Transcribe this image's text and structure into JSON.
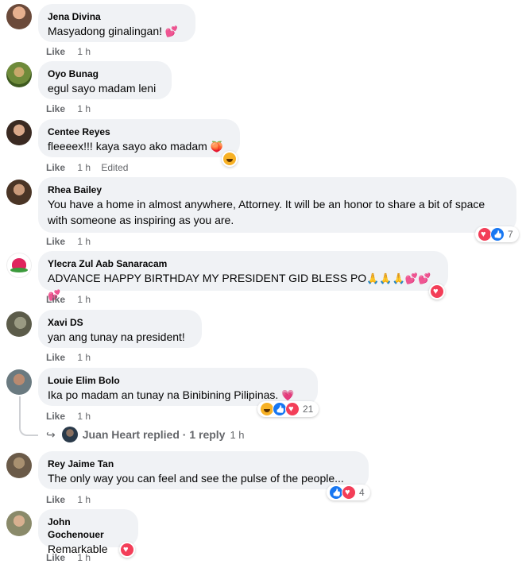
{
  "comments": [
    {
      "author": "Jena Divina",
      "text": "Masyadong ginalingan! ",
      "like": "Like",
      "time": "1 h"
    },
    {
      "author": "Oyo Bunag",
      "text": "egul sayo madam leni",
      "like": "Like",
      "time": "1 h"
    },
    {
      "author": "Centee Reyes",
      "text": "fleeeex!!! kaya sayo ako madam ",
      "like": "Like",
      "time": "1 h",
      "edited": "Edited"
    },
    {
      "author": "Rhea Bailey",
      "text": "You have a home in almost anywhere, Attorney. It will be an honor to share a bit of space with someone as inspiring as you are.",
      "like": "Like",
      "time": "1 h",
      "reaction_count": "7"
    },
    {
      "author": "Ylecra Zul Aab Sanaracam",
      "text": "ADVANCE HAPPY BIRTHDAY MY PRESIDENT GID BLESS PO",
      "like": "Like",
      "time": "1 h"
    },
    {
      "author": "Xavi DS",
      "text": "yan ang tunay na president!",
      "like": "Like",
      "time": "1 h"
    },
    {
      "author": "Louie Elim Bolo",
      "text": "Ika po madam an tunay na Binibining Pilipinas. ",
      "like": "Like",
      "time": "1 h",
      "reaction_count": "21"
    },
    {
      "author": "Rey Jaime Tan",
      "text": "The only way you can feel and see the pulse of the people...",
      "like": "Like",
      "time": "1 h",
      "reaction_count": "4"
    },
    {
      "author": "John Gochenouer",
      "text": "Remarkable",
      "like": "Like",
      "time": "1 h"
    }
  ],
  "reply": {
    "text": "Juan Heart replied · 1 reply",
    "time": "1 h"
  },
  "colors": {
    "bubble": "#f0f2f5",
    "meta": "#65676b",
    "heart": "#f33e58",
    "like": "#1877f2",
    "haha": "#f7b125"
  },
  "icons": {
    "reply_arrow": "reply-arrow-icon",
    "heart": "heart-reaction-icon",
    "like": "like-reaction-icon",
    "haha": "haha-reaction-icon"
  }
}
